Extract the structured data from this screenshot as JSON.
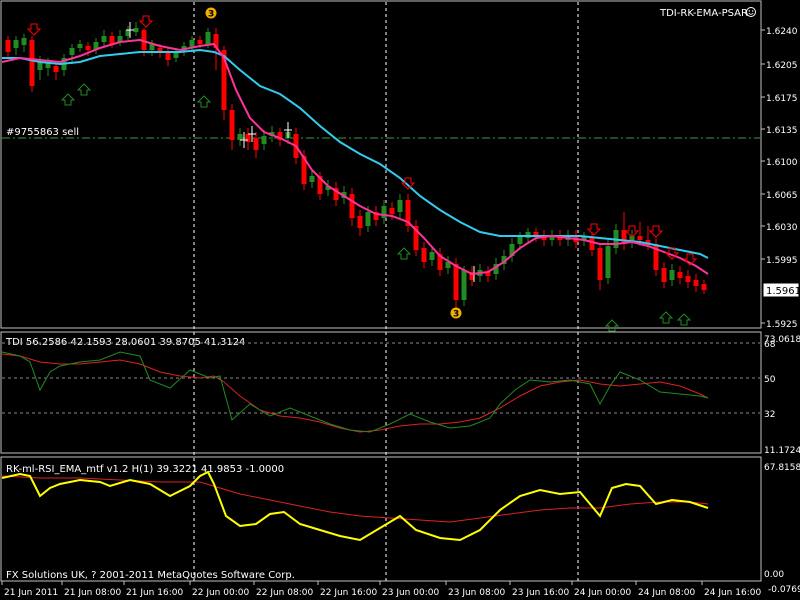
{
  "window": {
    "indicator_name": "TDI-RK-EMA-PSAR",
    "copyright": "FX Solutions UK, ? 2001-2011 MetaQuotes Software Corp."
  },
  "main_panel": {
    "price_ticks": [
      "1.6240",
      "1.6205",
      "1.6175",
      "1.6135",
      "1.6100",
      "1.6065",
      "1.6030",
      "1.5995",
      "1.5961",
      "1.5925"
    ],
    "current_price": "1.5961",
    "order_line_label": "#9755863 sell",
    "order_marker": "3",
    "colors": {
      "ema_fast": "#ff3399",
      "ema_slow": "#33ccee",
      "bull": "#228b22",
      "bear": "#ff0000",
      "arrow_down": "#ff0000",
      "arrow_up": "#228b22"
    }
  },
  "tdi_panel": {
    "label": "TDI 56.2586 42.1593 28.0601 39.8705 41.3124",
    "ticks": [
      "73.0618",
      "68",
      "50",
      "32",
      "11.1724"
    ],
    "colors": {
      "fast": "#228b22",
      "slow": "#dd2222"
    }
  },
  "rsi_panel": {
    "label": "RK-ml-RSI_EMA_mtf v1.2 H(1) 39.3221 41.9853 -1.0000",
    "ticks": [
      "67.8158",
      "0.00"
    ],
    "bottom_tick": "-0.0769",
    "colors": {
      "rsi": "#ffff00",
      "ema": "#dd2222"
    }
  },
  "time_axis": [
    "21 Jun 2011",
    "21 Jun 08:00",
    "21 Jun 16:00",
    "22 Jun 00:00",
    "22 Jun 08:00",
    "22 Jun 16:00",
    "23 Jun 00:00",
    "23 Jun 08:00",
    "23 Jun 16:00",
    "24 Jun 00:00",
    "24 Jun 08:00",
    "24 Jun 16:00"
  ]
}
